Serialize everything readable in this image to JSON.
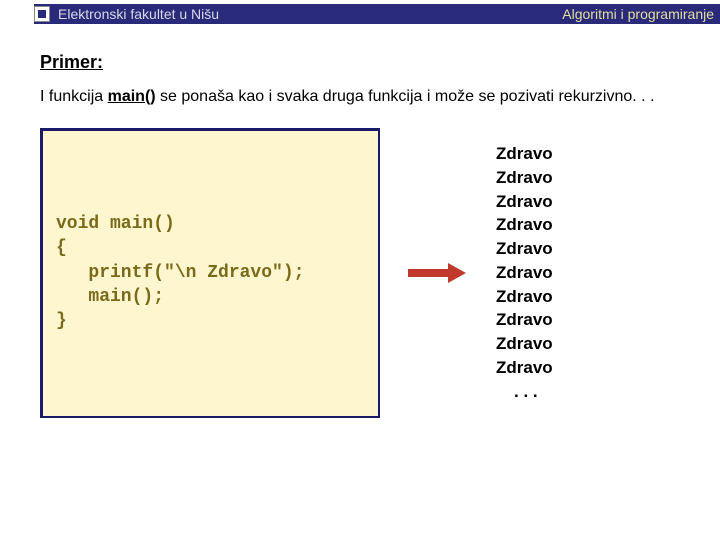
{
  "header": {
    "left": "Elektronski fakultet u Nišu",
    "right": "Algoritmi i programiranje"
  },
  "section": {
    "title": "Primer:",
    "desc_before": "I funkcija ",
    "desc_bold": "main()",
    "desc_after": " se ponaša kao i svaka druga funkcija i može se pozivati rekurzivno. . ."
  },
  "code": "void main()\n{\n   printf(\"\\n Zdravo\");\n   main();\n}",
  "output": {
    "lines": [
      "Zdravo",
      "Zdravo",
      "Zdravo",
      "Zdravo",
      "Zdravo",
      "Zdravo",
      "Zdravo",
      "Zdravo",
      "Zdravo",
      "Zdravo"
    ],
    "ellipsis": ". . ."
  }
}
